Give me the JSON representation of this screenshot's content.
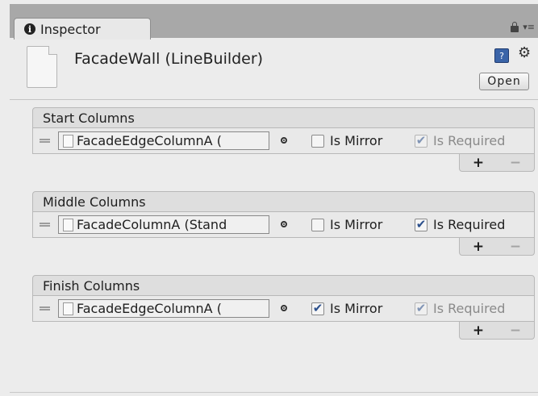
{
  "tab": {
    "label": "Inspector"
  },
  "header": {
    "title": "FacadeWall (LineBuilder)",
    "open_label": "Open",
    "help_symbol": "?",
    "gear_symbol": "⚙"
  },
  "tab_tools": {
    "menu_symbol": "▾≡"
  },
  "lists": [
    {
      "title": "Start Columns",
      "field_value": "FacadeEdgeColumnA (",
      "is_mirror_label": "Is Mirror",
      "is_mirror": false,
      "is_required_label": "Is Required",
      "is_required": true,
      "is_required_enabled": false
    },
    {
      "title": "Middle Columns",
      "field_value": "FacadeColumnA (Stand",
      "is_mirror_label": "Is Mirror",
      "is_mirror": false,
      "is_required_label": "Is Required",
      "is_required": true,
      "is_required_enabled": true
    },
    {
      "title": "Finish Columns",
      "field_value": "FacadeEdgeColumnA (",
      "is_mirror_label": "Is Mirror",
      "is_mirror": true,
      "is_required_label": "Is Required",
      "is_required": true,
      "is_required_enabled": false
    }
  ],
  "footer": {
    "add_symbol": "+",
    "remove_symbol": "−"
  },
  "colors": {
    "check_accent": "#2b4f8c",
    "tabbar_bg": "#a8a8a8"
  }
}
